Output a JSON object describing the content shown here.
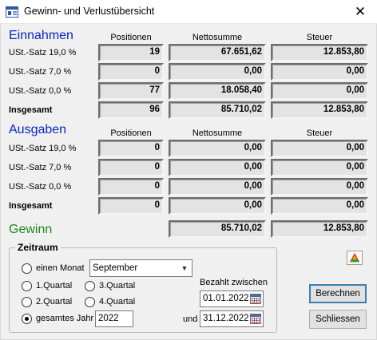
{
  "window": {
    "title": "Gewinn- und Verlustübersicht",
    "close_glyph": "✕",
    "app_icon": "app-window-icon"
  },
  "columns": {
    "positionen": "Positionen",
    "nettosumme": "Nettosumme",
    "steuer": "Steuer"
  },
  "einnahmen": {
    "title": "Einnahmen",
    "rows": [
      {
        "label": "USt.-Satz 19,0 %",
        "positionen": "19",
        "nettosumme": "67.651,62",
        "steuer": "12.853,80"
      },
      {
        "label": "USt.-Satz 7,0 %",
        "positionen": "0",
        "nettosumme": "0,00",
        "steuer": "0,00"
      },
      {
        "label": "USt.-Satz 0,0 %",
        "positionen": "77",
        "nettosumme": "18.058,40",
        "steuer": "0,00"
      },
      {
        "label": "Insgesamt",
        "positionen": "96",
        "nettosumme": "85.710,02",
        "steuer": "12.853,80"
      }
    ]
  },
  "ausgaben": {
    "title": "Ausgaben",
    "rows": [
      {
        "label": "USt.-Satz 19,0 %",
        "positionen": "0",
        "nettosumme": "0,00",
        "steuer": "0,00"
      },
      {
        "label": "USt.-Satz 7,0 %",
        "positionen": "0",
        "nettosumme": "0,00",
        "steuer": "0,00"
      },
      {
        "label": "USt.-Satz 0,0 %",
        "positionen": "0",
        "nettosumme": "0,00",
        "steuer": "0,00"
      },
      {
        "label": "Insgesamt",
        "positionen": "0",
        "nettosumme": "0,00",
        "steuer": "0,00"
      }
    ]
  },
  "gewinn": {
    "title": "Gewinn",
    "nettosumme": "85.710,02",
    "steuer": "12.853,80"
  },
  "zeitraum": {
    "title": "Zeitraum",
    "einen_monat": "einen Monat",
    "monat_value": "September",
    "q1": "1.Quartal",
    "q2": "2.Quartal",
    "q3": "3.Quartal",
    "q4": "4.Quartal",
    "gesamtes_jahr": "gesamtes Jahr",
    "jahr_value": "2022",
    "selected": "gesamtes Jahr",
    "bezahlt_label": "Bezahlt zwischen",
    "von_value": "01.01.2022",
    "und_label": "und",
    "bis_value": "31.12.2022"
  },
  "buttons": {
    "berechnen": "Berechnen",
    "schliessen": "Schliessen"
  },
  "icons": {
    "chart": "chart-icon",
    "calendar": "calendar-icon",
    "dropdown": "chevron-down-icon"
  },
  "colors": {
    "section_blue": "#0a24c8",
    "gewinn_green": "#1a8a1a",
    "default_button_border": "#3c7fb1"
  }
}
